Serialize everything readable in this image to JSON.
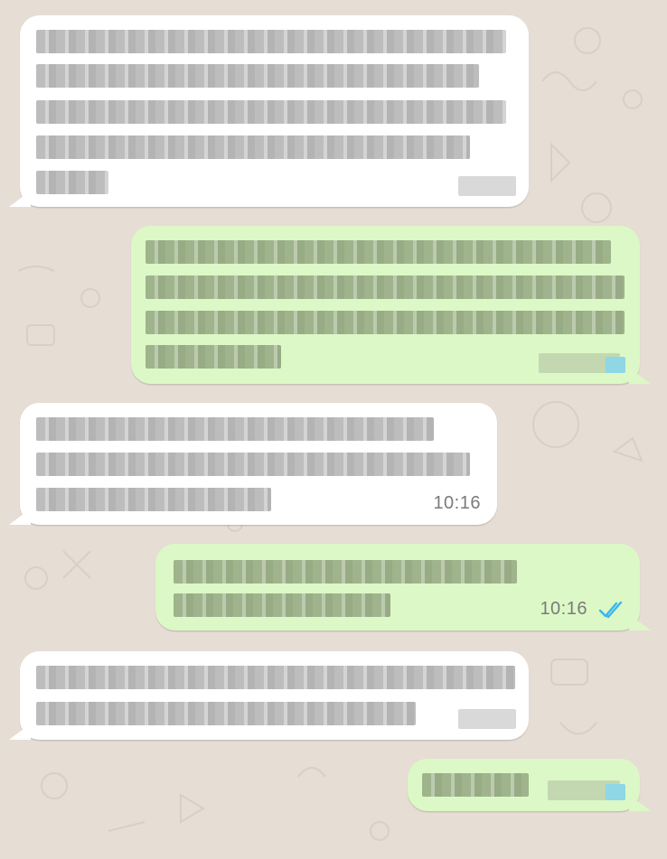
{
  "conversation": {
    "messages": [
      {
        "direction": "incoming",
        "text_visible": false,
        "time": null
      },
      {
        "direction": "outgoing",
        "text_visible": false,
        "time": null,
        "status": "read"
      },
      {
        "direction": "incoming",
        "text_visible": false,
        "time": "10:16"
      },
      {
        "direction": "outgoing",
        "text_visible": false,
        "time": "10:16",
        "status": "read"
      },
      {
        "direction": "incoming",
        "text_visible": false,
        "time": null
      },
      {
        "direction": "outgoing",
        "text_visible": false,
        "time": null,
        "status": "read"
      }
    ]
  },
  "colors": {
    "background": "#e6ddd4",
    "incoming_bubble": "#ffffff",
    "outgoing_bubble": "#dcf8c6",
    "timestamp": "#7b7b7b",
    "read_ticks": "#34b7f1"
  },
  "icons": {
    "read_receipt": "double-check-icon"
  }
}
